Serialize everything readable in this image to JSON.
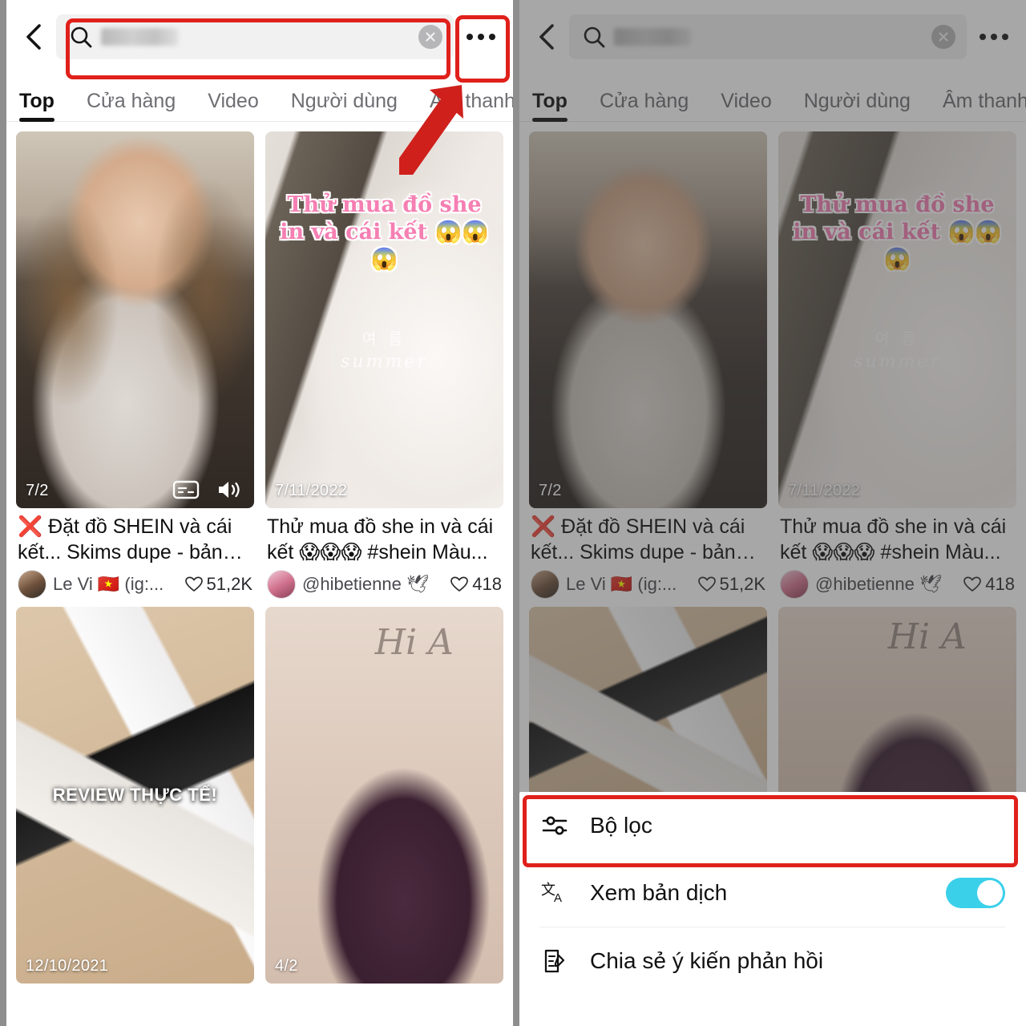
{
  "app": {
    "name": "tiktok-search-results",
    "accent_red": "#e0201b",
    "toggle_on_color": "#3ad0ea",
    "heart_color": "#2b2b2f"
  },
  "header": {
    "back_icon": "chevron-left-icon",
    "search_icon": "search-icon",
    "search_value": "Shein",
    "search_value_redacted": true,
    "clear_icon": "clear-circle-icon",
    "more_icon": "more-horizontal-icon"
  },
  "tabs": [
    {
      "label": "Top",
      "active": true
    },
    {
      "label": "Cửa hàng",
      "active": false
    },
    {
      "label": "Video",
      "active": false
    },
    {
      "label": "Người dùng",
      "active": false
    },
    {
      "label": "Âm thanh",
      "active": false
    }
  ],
  "results": [
    {
      "date": "7/2",
      "has_caption_icon": true,
      "has_sound_icon": true,
      "title_prefix": "❌",
      "title": "Đặt đồ SHEIN và cái kết... Skims dupe - bản c...",
      "author": "Le  Vi 🇻🇳 (ig:...",
      "likes": "51,2K"
    },
    {
      "date": "7/11/2022",
      "overlay_text": "Thử mua đồ she in và cái kết 😱😱😱",
      "watermark_kr": "여 름",
      "watermark_en": "summer",
      "title": "Thử mua đồ she in và cái kết 😱😱😱 #shein Màu...",
      "author": "@hibetienne 🕊",
      "likes": "418"
    },
    {
      "date": "12/10/2021",
      "overlay_text": "REVIEW THỰC TẾ!"
    },
    {
      "date": "4/2",
      "signature": "Hi A"
    }
  ],
  "sheet": {
    "items": [
      {
        "label": "Bộ lọc",
        "icon": "sliders-icon",
        "has_toggle": false,
        "highlighted": true
      },
      {
        "label": "Xem bản dịch",
        "icon": "translate-icon",
        "has_toggle": true,
        "toggle_on": true
      },
      {
        "label": "Chia sẻ ý kiến phản hồi",
        "icon": "feedback-note-icon",
        "has_toggle": false
      }
    ]
  },
  "annotations": {
    "search_box_highlight": true,
    "more_button_highlight": true,
    "filter_row_highlight": true,
    "arrow_points_to": "more-horizontal-icon"
  }
}
